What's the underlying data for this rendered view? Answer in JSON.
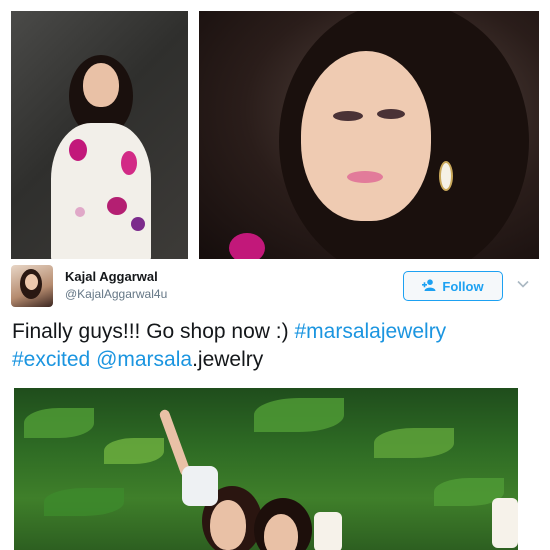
{
  "tweet": {
    "author_name": "Kajal Aggarwal",
    "author_handle": "@KajalAggarwal4u",
    "follow_label": "Follow",
    "text_line1_plain": "Finally guys!!! Go shop now :) ",
    "text_line1_hashtag": "#marsalajewelry",
    "text_line2_hashtag": "#excited",
    "text_line2_space": " ",
    "text_line2_mention": "@marsala",
    "text_line2_plain": ".jewelry"
  },
  "colors": {
    "link": "#1b95e0",
    "follow_border": "#1da1f2",
    "handle": "#657786",
    "text": "#14171a"
  },
  "icons": {
    "follow": "person-plus-icon",
    "more": "chevron-down-icon"
  }
}
